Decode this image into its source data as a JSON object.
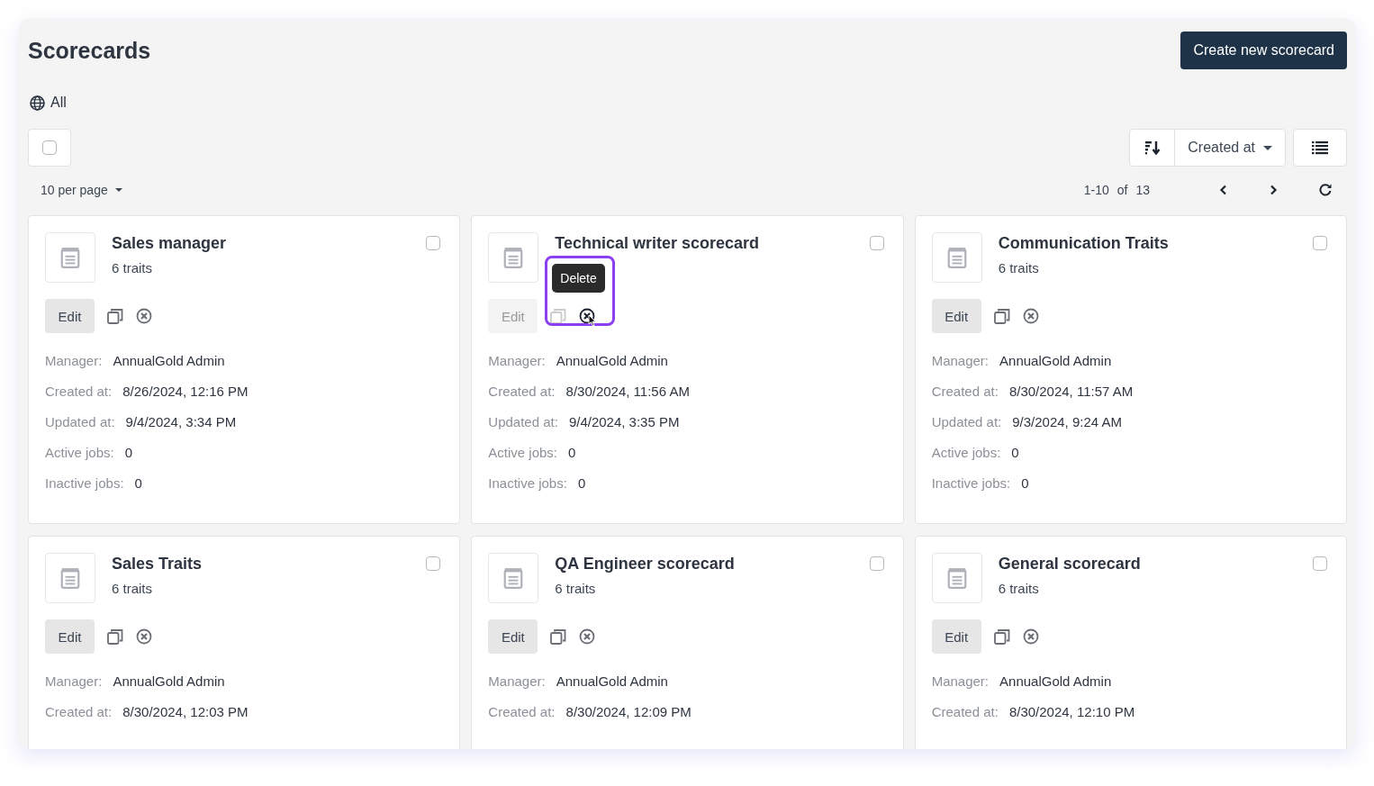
{
  "page": {
    "title": "Scorecards",
    "create_button": "Create new scorecard"
  },
  "filter": {
    "label": "All"
  },
  "toolbar": {
    "select_all": {
      "checked": false
    },
    "sort_field": "Created at",
    "per_page": "10 per page",
    "range": "1-10",
    "of_label": "of",
    "total": "13"
  },
  "cards": [
    {
      "title": "Sales manager",
      "traits": "6 traits",
      "edit": "Edit",
      "checked": false,
      "disabled": false,
      "fields": [
        {
          "label": "Manager:",
          "value": "AnnualGold Admin"
        },
        {
          "label": "Created at:",
          "value": "8/26/2024, 12:16 PM"
        },
        {
          "label": "Updated at:",
          "value": "9/4/2024, 3:34 PM"
        },
        {
          "label": "Active jobs:",
          "value": "0"
        },
        {
          "label": "Inactive jobs:",
          "value": "0"
        }
      ]
    },
    {
      "title": "Technical writer scorecard",
      "edit": "Edit",
      "checked": false,
      "disabled": true,
      "tooltip": "Delete",
      "fields": [
        {
          "label": "Manager:",
          "value": "AnnualGold Admin"
        },
        {
          "label": "Created at:",
          "value": "8/30/2024, 11:56 AM"
        },
        {
          "label": "Updated at:",
          "value": "9/4/2024, 3:35 PM"
        },
        {
          "label": "Active jobs:",
          "value": "0"
        },
        {
          "label": "Inactive jobs:",
          "value": "0"
        }
      ]
    },
    {
      "title": "Communication Traits",
      "traits": "6 traits",
      "edit": "Edit",
      "checked": false,
      "disabled": false,
      "fields": [
        {
          "label": "Manager:",
          "value": "AnnualGold Admin"
        },
        {
          "label": "Created at:",
          "value": "8/30/2024, 11:57 AM"
        },
        {
          "label": "Updated at:",
          "value": "9/3/2024, 9:24 AM"
        },
        {
          "label": "Active jobs:",
          "value": "0"
        },
        {
          "label": "Inactive jobs:",
          "value": "0"
        }
      ]
    },
    {
      "title": "Sales Traits",
      "traits": "6 traits",
      "edit": "Edit",
      "checked": false,
      "disabled": false,
      "fields": [
        {
          "label": "Manager:",
          "value": "AnnualGold Admin"
        },
        {
          "label": "Created at:",
          "value": "8/30/2024, 12:03 PM"
        }
      ]
    },
    {
      "title": "QA Engineer scorecard",
      "traits": "6 traits",
      "edit": "Edit",
      "checked": false,
      "disabled": false,
      "fields": [
        {
          "label": "Manager:",
          "value": "AnnualGold Admin"
        },
        {
          "label": "Created at:",
          "value": "8/30/2024, 12:09 PM"
        }
      ]
    },
    {
      "title": "General scorecard",
      "traits": "6 traits",
      "edit": "Edit",
      "checked": false,
      "disabled": false,
      "fields": [
        {
          "label": "Manager:",
          "value": "AnnualGold Admin"
        },
        {
          "label": "Created at:",
          "value": "8/30/2024, 12:10 PM"
        }
      ]
    }
  ]
}
